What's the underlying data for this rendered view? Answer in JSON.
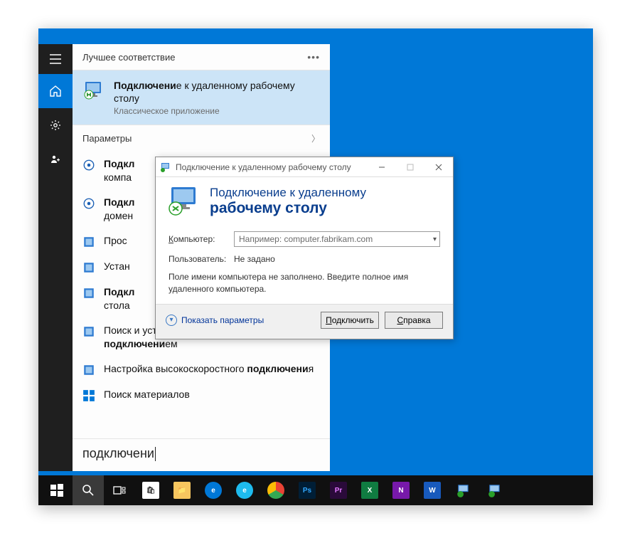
{
  "startmenu": {
    "header": "Лучшее соответствие",
    "best_match": {
      "prefix_bold": "Подключени",
      "title_rest": "е к удаленному рабочему столу",
      "subtitle": "Классическое приложение"
    },
    "section_params": "Параметры",
    "items": [
      {
        "prefix": "Подкл",
        "truncated": true,
        "line2_prefix": "компа"
      },
      {
        "prefix": "Подкл",
        "truncated": true,
        "line2_prefix": "домен"
      },
      {
        "prefix": "Прос",
        "truncated": true
      },
      {
        "prefix": "Устан",
        "truncated": true
      },
      {
        "prefix_bold": "Подкл",
        "truncated": true,
        "line2_prefix": "стола"
      },
      {
        "text": "Поиск и устранение проблем с сетью и ",
        "bold_tail": "подключени",
        "tail": "ем"
      },
      {
        "text": "Настройка высокоскоростного ",
        "bold_tail": "подключени",
        "tail": "я"
      }
    ],
    "materials_label": "Поиск материалов",
    "search_value": "подключени"
  },
  "rdp": {
    "title": "Подключение к удаленному рабочему столу",
    "heading_line1": "Подключение к удаленному",
    "heading_line2": "рабочему столу",
    "computer_label": "Компьютер:",
    "computer_underline_char": "К",
    "computer_placeholder": "Например: computer.fabrikam.com",
    "user_label": "Пользователь:",
    "user_value": "Не задано",
    "info_text": "Поле имени компьютера не заполнено. Введите полное имя удаленного компьютера.",
    "show_params": "Показать параметры",
    "show_params_underline_char": "П",
    "connect_label": "Подключить",
    "connect_underline_char": "П",
    "help_label": "Справка",
    "help_underline_char": "С"
  },
  "taskbar": {
    "apps": [
      "start",
      "search",
      "taskview",
      "store",
      "explorer",
      "edge",
      "ie",
      "chrome",
      "ps",
      "pr",
      "excel",
      "onenote",
      "word",
      "rdp1",
      "rdp2"
    ]
  }
}
